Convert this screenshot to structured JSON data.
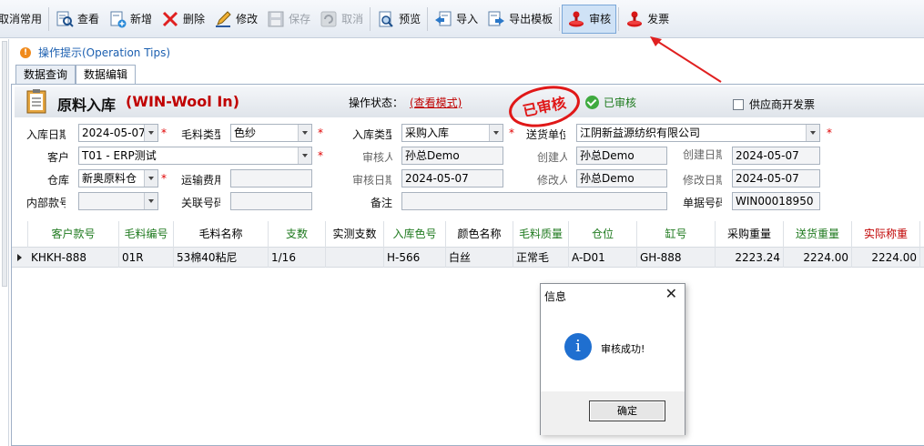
{
  "toolbar": {
    "items": [
      {
        "label": "取消常用",
        "icon": "cancel-favorite-icon"
      },
      {
        "label": "查看",
        "icon": "view-icon"
      },
      {
        "label": "新增",
        "icon": "add-icon"
      },
      {
        "label": "删除",
        "icon": "delete-icon"
      },
      {
        "label": "修改",
        "icon": "edit-icon"
      },
      {
        "label": "保存",
        "icon": "save-icon"
      },
      {
        "label": "取消",
        "icon": "cancel-icon"
      },
      {
        "label": "预览",
        "icon": "preview-icon"
      },
      {
        "label": "导入",
        "icon": "import-icon"
      },
      {
        "label": "导出模板",
        "icon": "export-template-icon"
      },
      {
        "label": "审核",
        "icon": "audit-stamp-icon"
      },
      {
        "label": "发票",
        "icon": "invoice-stamp-icon"
      }
    ]
  },
  "tips": {
    "text": "操作提示(Operation Tips)"
  },
  "tabs": [
    {
      "label": "数据查询"
    },
    {
      "label": "数据编辑"
    }
  ],
  "header": {
    "title": "原料入库",
    "title_en": "(WIN-Wool In)",
    "op_status_label": "操作状态：",
    "op_status_value": "(查看模式)",
    "audited": "已审核",
    "stamp_text": "已审核",
    "supplier_invoice": "供应商开发票"
  },
  "form": {
    "in_date_label": "入库日期",
    "in_date": "2024-05-07",
    "wool_type_label": "毛料类型",
    "wool_type": "色纱",
    "in_type_label": "入库类型",
    "in_type": "采购入库",
    "supplier_label": "送货单位",
    "supplier": "江阴新益源纺织有限公司",
    "customer_label": "客户",
    "customer": "T01 - ERP测试",
    "auditor_label": "审核人",
    "auditor": "孙总Demo",
    "creator_label": "创建人",
    "creator": "孙总Demo",
    "create_date_label": "创建日期",
    "create_date": "2024-05-07",
    "warehouse_label": "仓库",
    "warehouse": "新奥原料仓",
    "freight_label": "运输费用",
    "freight": "",
    "audit_date_label": "审核日期",
    "audit_date": "2024-05-07",
    "modifier_label": "修改人",
    "modifier": "孙总Demo",
    "modify_date_label": "修改日期",
    "modify_date": "2024-05-07",
    "internal_style_label": "内部款号",
    "internal_style": "",
    "related_no_label": "关联号码",
    "related_no": "",
    "remark_label": "备注",
    "remark": "",
    "doc_no_label": "单据号码",
    "doc_no": "WIN00018950"
  },
  "grid": {
    "headers": [
      "客户款号",
      "毛料编号",
      "毛料名称",
      "支数",
      "实测支数",
      "入库色号",
      "颜色名称",
      "毛料质量",
      "仓位",
      "缸号",
      "采购重量",
      "送货重量",
      "实际称重"
    ],
    "rows": [
      [
        "KHKH-888",
        "01R",
        "53棉40粘尼",
        "1/16",
        "",
        "H-566",
        "白丝",
        "正常毛",
        "A-D01",
        "GH-888",
        "2223.24",
        "2224.00",
        "2224.00"
      ]
    ]
  },
  "dialog": {
    "title": "信息",
    "message": "审核成功!",
    "ok": "确定"
  },
  "colors": {
    "accent_red": "#c00000",
    "accent_green": "#1f7a1f",
    "link_blue": "#1b5fb0",
    "stamp_red": "#e01818"
  }
}
